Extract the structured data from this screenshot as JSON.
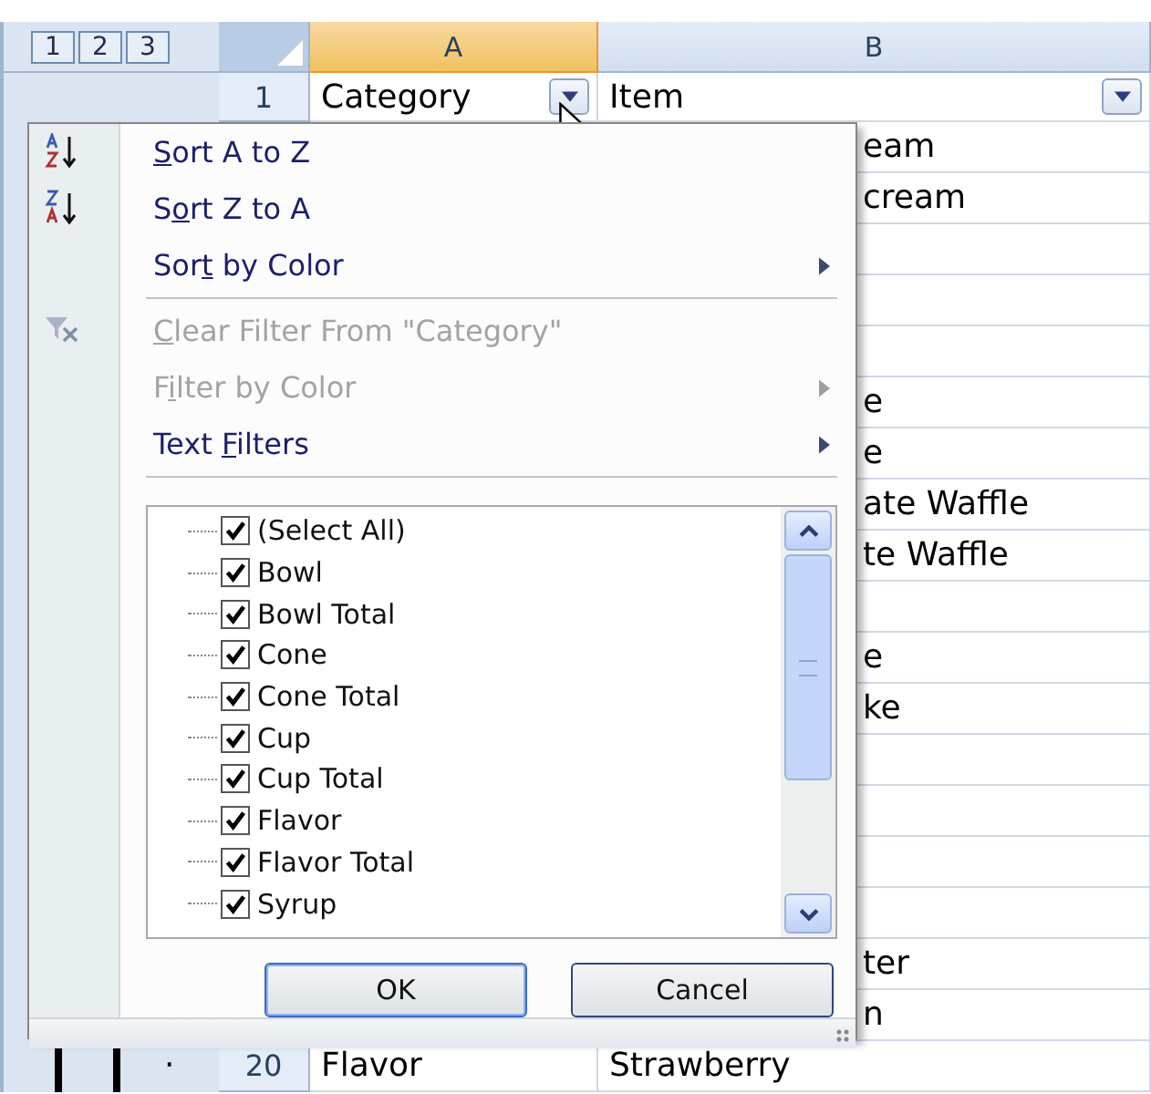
{
  "outline_levels": [
    {
      "label": "1"
    },
    {
      "label": "2"
    },
    {
      "label": "3"
    }
  ],
  "columns": [
    {
      "label": "A",
      "selected": true
    },
    {
      "label": "B",
      "selected": false
    }
  ],
  "header_row": {
    "number": "1",
    "cells": [
      "Category",
      "Item"
    ]
  },
  "covered_rows": [
    {
      "item": "eam"
    },
    {
      "item": "cream"
    },
    {
      "item": ""
    },
    {
      "item": ""
    },
    {
      "item": ""
    },
    {
      "item": "e"
    },
    {
      "item": "e"
    },
    {
      "item": "ate Waffle"
    },
    {
      "item": "te Waffle"
    },
    {
      "item": ""
    },
    {
      "item": "e"
    },
    {
      "item": "ke"
    },
    {
      "item": ""
    },
    {
      "item": ""
    },
    {
      "item": ""
    },
    {
      "item": ""
    },
    {
      "item": "ter"
    },
    {
      "item": "n"
    }
  ],
  "last_row": {
    "marker": "·",
    "number": "20",
    "category": "Flavor",
    "item": "Strawberry"
  },
  "menu": {
    "items": [
      {
        "kind": "command",
        "key": "S",
        "post": "ort A to Z",
        "disabled": false,
        "submenu": false
      },
      {
        "kind": "command",
        "pre": "S",
        "key": "o",
        "post": "rt Z to A",
        "disabled": false,
        "submenu": false
      },
      {
        "kind": "command",
        "pre": "Sor",
        "key": "t",
        "post": " by Color",
        "disabled": false,
        "submenu": true
      },
      {
        "kind": "separator"
      },
      {
        "kind": "command",
        "key": "C",
        "post": "lear Filter From \"Category\"",
        "disabled": true,
        "submenu": false
      },
      {
        "kind": "command",
        "pre": "F",
        "key": "i",
        "post": "lter by Color",
        "disabled": true,
        "submenu": true
      },
      {
        "kind": "command",
        "pre": "Text ",
        "key": "F",
        "post": "ilters",
        "disabled": false,
        "submenu": true
      },
      {
        "kind": "separator"
      }
    ],
    "filter_list": [
      {
        "label": "(Select All)",
        "checked": true
      },
      {
        "label": "Bowl",
        "checked": true
      },
      {
        "label": "Bowl Total",
        "checked": true
      },
      {
        "label": "Cone",
        "checked": true
      },
      {
        "label": "Cone Total",
        "checked": true
      },
      {
        "label": "Cup",
        "checked": true
      },
      {
        "label": "Cup Total",
        "checked": true
      },
      {
        "label": "Flavor",
        "checked": true
      },
      {
        "label": "Flavor Total",
        "checked": true
      },
      {
        "label": "Syrup",
        "checked": true
      }
    ],
    "buttons": [
      {
        "label": "OK",
        "default": true
      },
      {
        "label": "Cancel",
        "default": false
      }
    ]
  }
}
